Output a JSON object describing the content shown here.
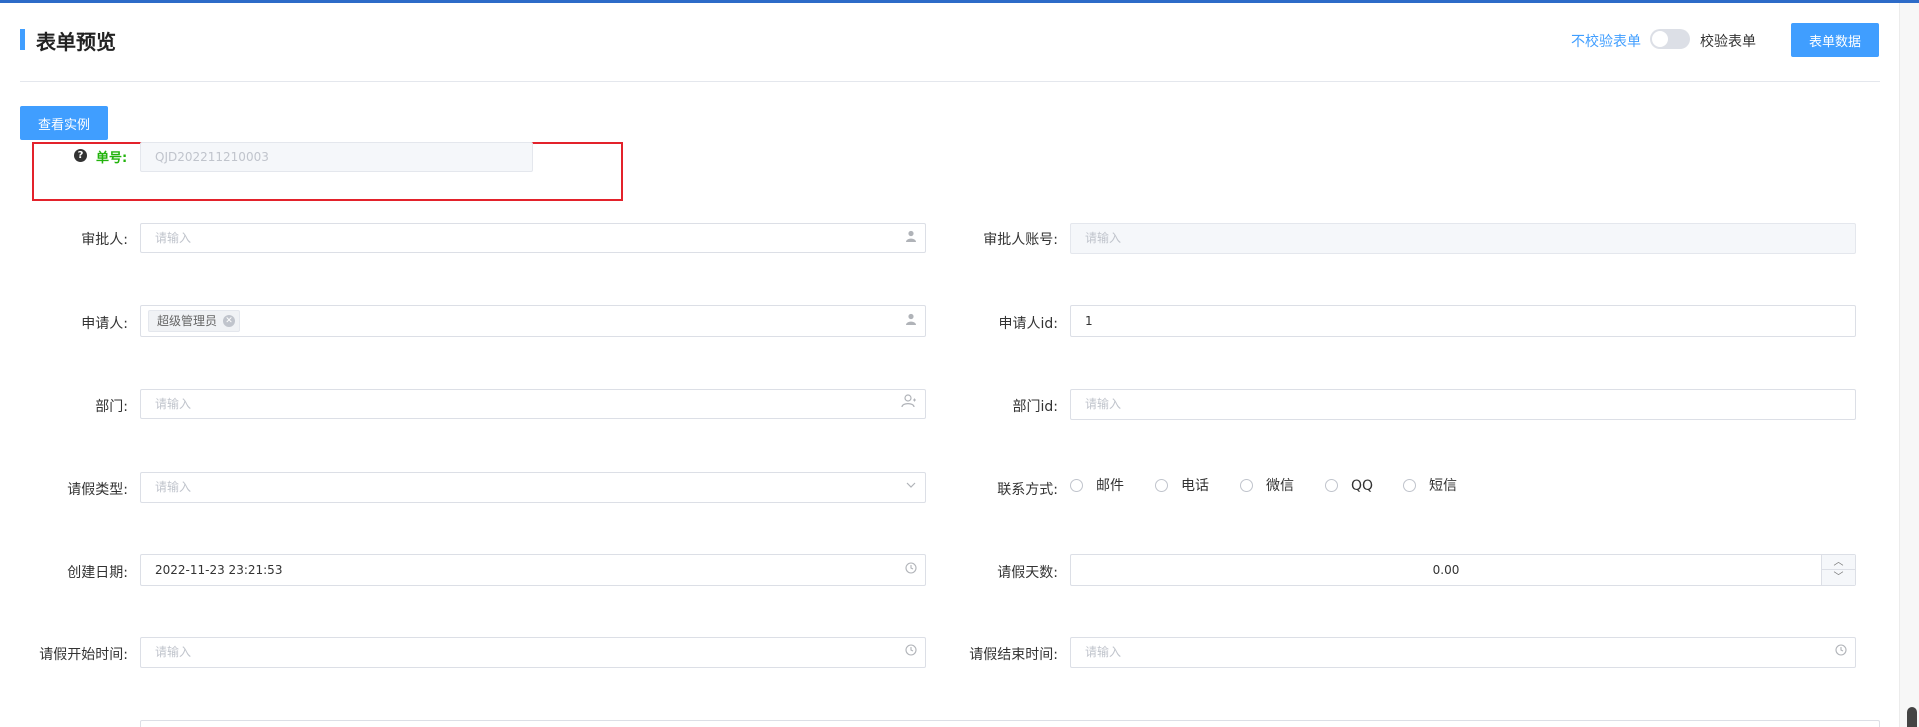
{
  "header": {
    "title": "表单预览",
    "no_validate_label": "不校验表单",
    "validate_label": "校验表单",
    "form_data_button": "表单数据"
  },
  "toolbar": {
    "example_button": "查看实例"
  },
  "form": {
    "order_no": {
      "label": "单号:",
      "value": "QJD202211210003"
    },
    "approver": {
      "label": "审批人:",
      "placeholder": "请输入"
    },
    "approver_account": {
      "label": "审批人账号:",
      "placeholder": "请输入"
    },
    "applicant": {
      "label": "申请人:",
      "tag": "超级管理员"
    },
    "applicant_id": {
      "label": "申请人id:",
      "value": "1"
    },
    "department": {
      "label": "部门:",
      "placeholder": "请输入"
    },
    "department_id": {
      "label": "部门id:",
      "placeholder": "请输入"
    },
    "leave_type": {
      "label": "请假类型:",
      "placeholder": "请输入"
    },
    "contact": {
      "label": "联系方式:",
      "options": [
        "邮件",
        "电话",
        "微信",
        "QQ",
        "短信"
      ]
    },
    "create_date": {
      "label": "创建日期:",
      "value": "2022-11-23 23:21:53"
    },
    "leave_days": {
      "label": "请假天数:",
      "value": "0.00"
    },
    "leave_start": {
      "label": "请假开始时间:",
      "placeholder": "请输入"
    },
    "leave_end": {
      "label": "请假结束时间:",
      "placeholder": "请输入"
    }
  },
  "colors": {
    "accent": "#409eff",
    "highlight": "#e3222b",
    "required_label": "#22b30c"
  },
  "icons": {
    "person": "user-icon",
    "department": "user-group-icon",
    "clock": "clock-icon",
    "dropdown": "chevron-down-icon",
    "help": "question-circle-icon"
  }
}
